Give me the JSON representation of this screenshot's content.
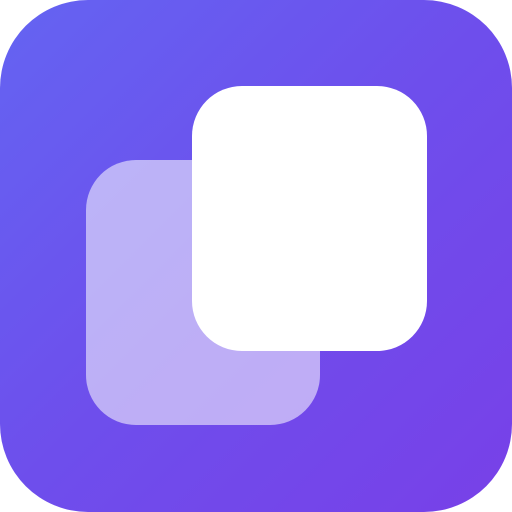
{
  "icon": {
    "name": "copy-icon",
    "colors": {
      "gradient_start": "#6464f2",
      "gradient_end": "#7840e8",
      "front_square": "#ffffff",
      "back_square": "rgba(255,255,255,0.55)"
    }
  }
}
